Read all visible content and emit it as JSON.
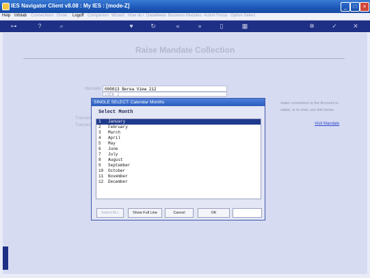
{
  "window": {
    "title": "IES Navigator Client v8.08 : My IES :     [mode-Z]"
  },
  "menu": {
    "items": [
      "Help",
      "Infolab",
      "Connections",
      "Ehow",
      "Logoff",
      "Companion",
      "Wizard",
      "How do I",
      "DataMeets",
      "Business Modules",
      "Action Focus",
      "Option Select"
    ]
  },
  "page": {
    "title": "Raise Mandate Collection",
    "mandate_label": "Mandate",
    "mandate_value": "000013 Berea View 212",
    "second_value": "LOCK 2",
    "text_left_1": "Transact",
    "text_left_2": "Transact",
    "side_text_1": "make corrections to the Account or",
    "side_text_2": "ndate, or to view, use link below.",
    "visit_link": "Visit Mandate"
  },
  "dialog": {
    "title": "SINGLE SELECT: Calendar Months",
    "heading": "Select Month",
    "items": [
      {
        "num": "1",
        "label": "January"
      },
      {
        "num": "2",
        "label": "February"
      },
      {
        "num": "3",
        "label": "March"
      },
      {
        "num": "4",
        "label": "April"
      },
      {
        "num": "5",
        "label": "May"
      },
      {
        "num": "6",
        "label": "June"
      },
      {
        "num": "7",
        "label": "July"
      },
      {
        "num": "8",
        "label": "August"
      },
      {
        "num": "9",
        "label": "September"
      },
      {
        "num": "10",
        "label": "October"
      },
      {
        "num": "11",
        "label": "November"
      },
      {
        "num": "12",
        "label": "December"
      }
    ],
    "buttons": {
      "select_all": "Select ALL",
      "show_full_line": "Show Full Line",
      "cancel": "Cancel",
      "ok": "OK"
    }
  }
}
